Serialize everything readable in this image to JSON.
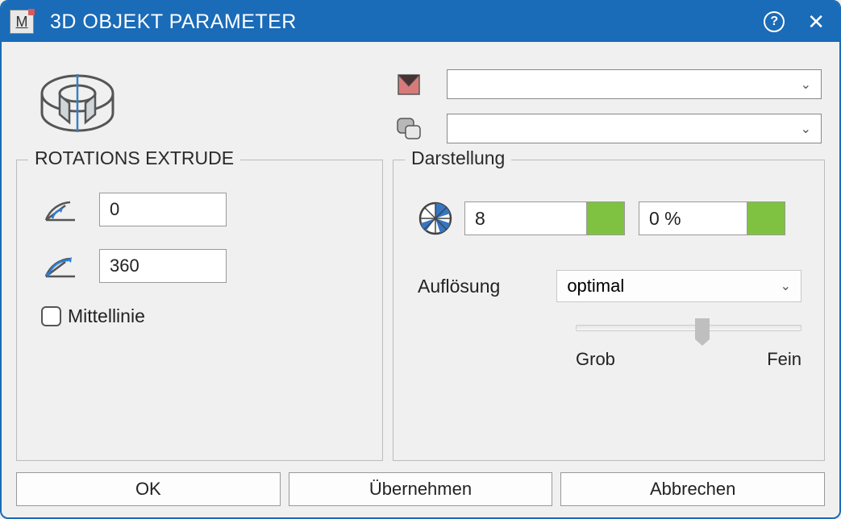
{
  "window": {
    "title": "3D OBJEKT PARAMETER"
  },
  "groups": {
    "rotations_extrude_title": "ROTATIONS EXTRUDE",
    "darstellung_title": "Darstellung"
  },
  "extrude": {
    "start_angle": "0",
    "end_angle": "360",
    "centerline_label": "Mittellinie"
  },
  "darstellung": {
    "sides_value": "8",
    "percent_value": "0 %",
    "resolution_label": "Auflösung",
    "resolution_value": "optimal",
    "slider_min_label": "Grob",
    "slider_max_label": "Fein"
  },
  "buttons": {
    "ok": "OK",
    "apply": "Übernehmen",
    "cancel": "Abbrechen"
  }
}
